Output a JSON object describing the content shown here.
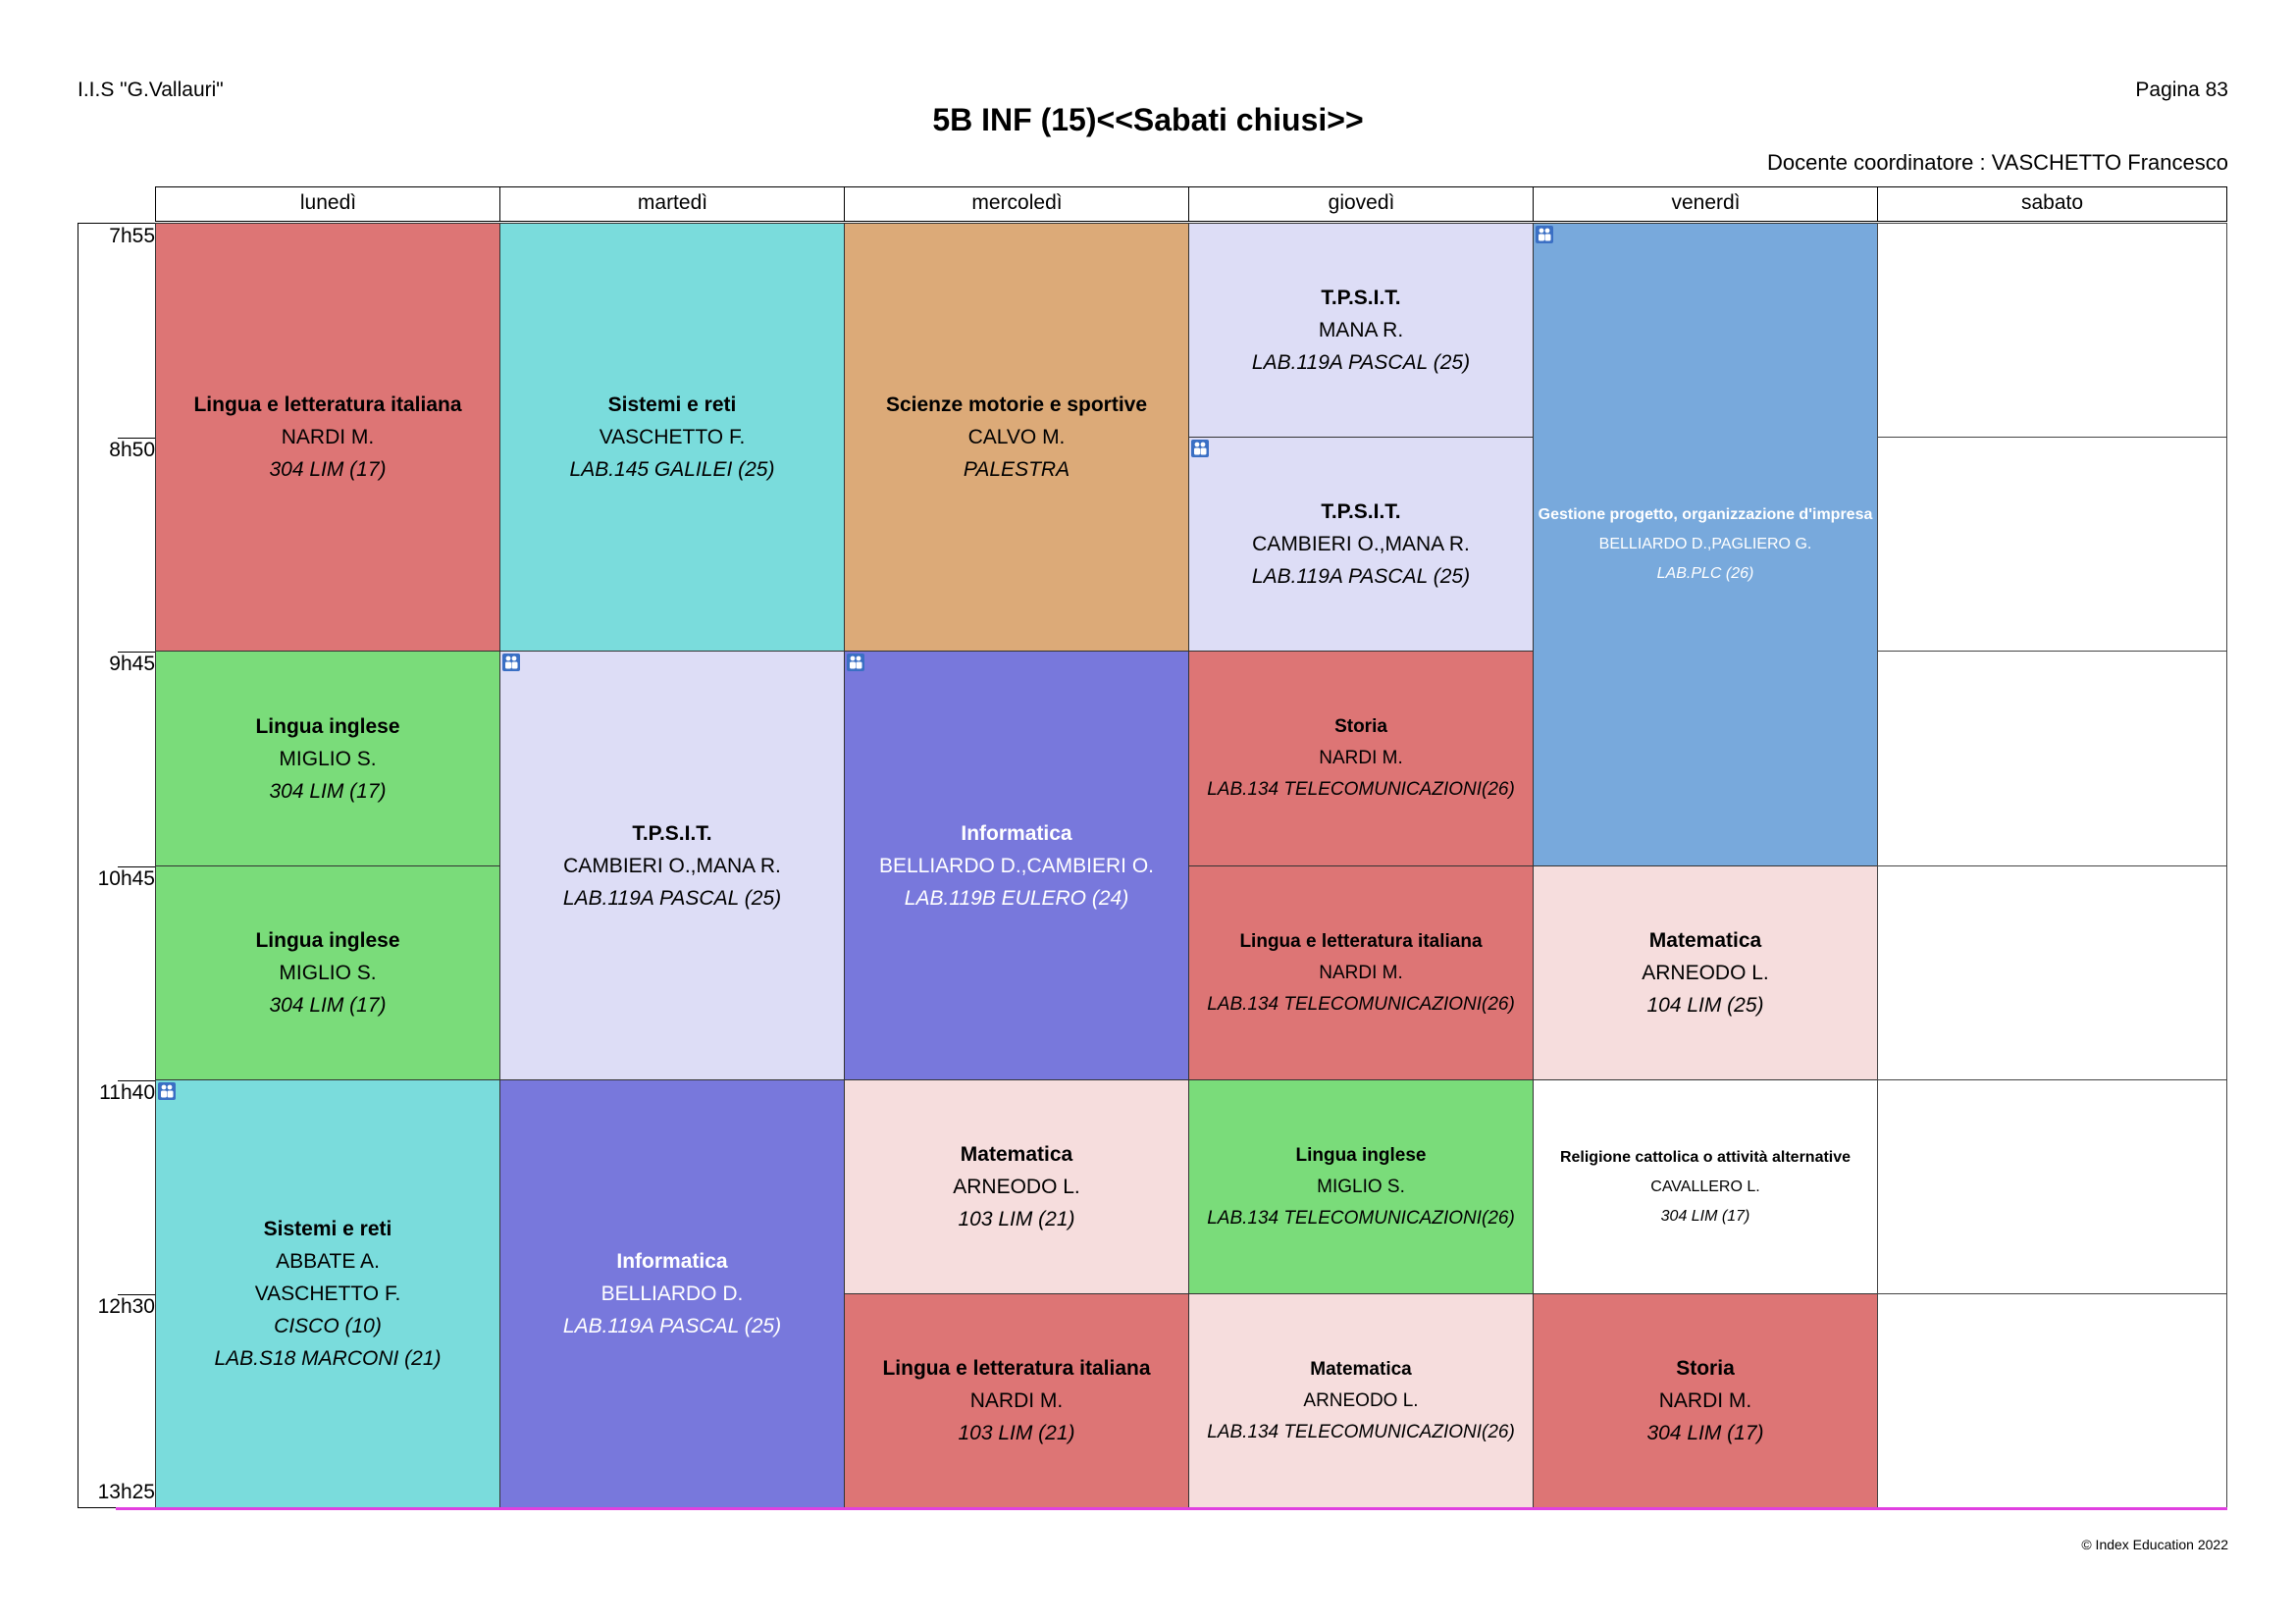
{
  "header": {
    "school": "I.I.S \"G.Vallauri\"",
    "page": "Pagina 83",
    "title": "5B INF  (15)<<Sabati chiusi>>",
    "coordinator": "Docente coordinatore : VASCHETTO Francesco"
  },
  "days": [
    "lunedì",
    "martedì",
    "mercoledì",
    "giovedì",
    "venerdì",
    "sabato"
  ],
  "times": [
    "7h55",
    "8h50",
    "9h45",
    "10h45",
    "11h40",
    "12h30",
    "13h25"
  ],
  "colors": {
    "italiano": "#dd7575",
    "sistemi": "#7adcdc",
    "motorie": "#dcaa78",
    "tpsit": "#ddddf6",
    "gestione": "#78a9dc",
    "inglese": "#7adc7a",
    "informatica": "#7878dc",
    "matematica": "#f6dddd",
    "religione": "#ffffff",
    "storia": "#dd7575"
  },
  "lessons": {
    "mon_1": {
      "subject": "Lingua e letteratura italiana",
      "teacher": "NARDI M.",
      "room": "304 LIM (17)"
    },
    "mon_2": {
      "subject": "Lingua inglese",
      "teacher": "MIGLIO S.",
      "room": "304 LIM (17)"
    },
    "mon_3": {
      "subject": "Lingua inglese",
      "teacher": "MIGLIO S.",
      "room": "304 LIM (17)"
    },
    "mon_4": {
      "subject": "Sistemi e reti",
      "teacher": "ABBATE A.",
      "teacher2": "VASCHETTO F.",
      "room": "CISCO (10)",
      "room2": "LAB.S18 MARCONI (21)"
    },
    "tue_1": {
      "subject": "Sistemi e reti",
      "teacher": "VASCHETTO F.",
      "room": "LAB.145 GALILEI (25)"
    },
    "tue_2": {
      "subject": "T.P.S.I.T.",
      "teacher": "CAMBIERI O.,MANA R.",
      "room": "LAB.119A PASCAL (25)"
    },
    "tue_3": {
      "subject": "Informatica",
      "teacher": "BELLIARDO D.",
      "room": "LAB.119A PASCAL (25)"
    },
    "wed_1": {
      "subject": "Scienze motorie e sportive",
      "teacher": "CALVO M.",
      "room": "PALESTRA"
    },
    "wed_2": {
      "subject": "Informatica",
      "teacher": "BELLIARDO D.,CAMBIERI O.",
      "room": "LAB.119B EULERO (24)"
    },
    "wed_3": {
      "subject": "Matematica",
      "teacher": "ARNEODO L.",
      "room": "103 LIM (21)"
    },
    "wed_4": {
      "subject": "Lingua e letteratura italiana",
      "teacher": "NARDI M.",
      "room": "103 LIM (21)"
    },
    "thu_1": {
      "subject": "T.P.S.I.T.",
      "teacher": "MANA R.",
      "room": "LAB.119A PASCAL (25)"
    },
    "thu_2": {
      "subject": "T.P.S.I.T.",
      "teacher": "CAMBIERI O.,MANA R.",
      "room": "LAB.119A PASCAL (25)"
    },
    "thu_3": {
      "subject": "Storia",
      "teacher": "NARDI M.",
      "room": "LAB.134 TELECOMUNICAZIONI(26)"
    },
    "thu_4": {
      "subject": "Lingua e letteratura italiana",
      "teacher": "NARDI M.",
      "room": "LAB.134 TELECOMUNICAZIONI(26)"
    },
    "thu_5": {
      "subject": "Lingua inglese",
      "teacher": "MIGLIO S.",
      "room": "LAB.134 TELECOMUNICAZIONI(26)"
    },
    "thu_6": {
      "subject": "Matematica",
      "teacher": "ARNEODO L.",
      "room": "LAB.134 TELECOMUNICAZIONI(26)"
    },
    "fri_1": {
      "subject": "Gestione progetto, organizzazione d'impresa",
      "teacher": "BELLIARDO D.,PAGLIERO G.",
      "room": "LAB.PLC (26)"
    },
    "fri_2": {
      "subject": "Matematica",
      "teacher": "ARNEODO L.",
      "room": "104 LIM (25)"
    },
    "fri_3": {
      "subject": "Religione cattolica o attività alternative",
      "teacher": "CAVALLERO L.",
      "room": "304 LIM (17)"
    },
    "fri_4": {
      "subject": "Storia",
      "teacher": "NARDI M.",
      "room": "304 LIM (17)"
    }
  },
  "footer": {
    "copyright": "© Index Education 2022"
  }
}
